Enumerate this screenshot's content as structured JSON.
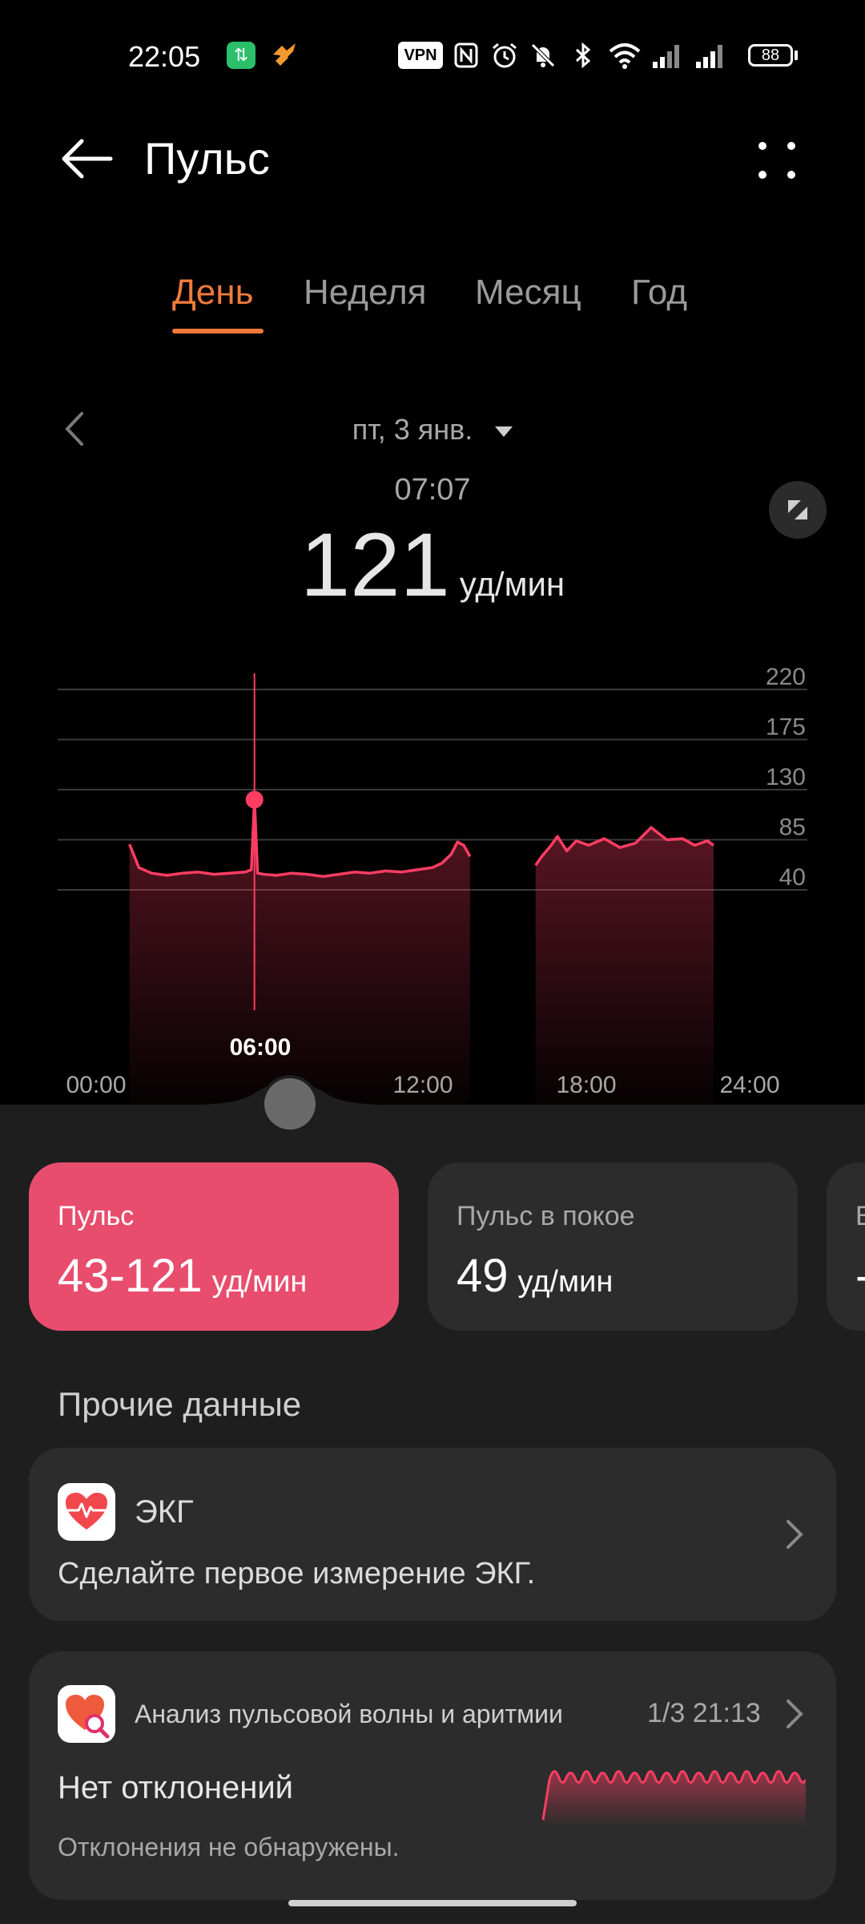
{
  "status_bar": {
    "time": "22:05",
    "icons": [
      "app-notification-green-icon",
      "app-notification-orange-icon",
      "vpn-badge",
      "nfc-icon",
      "alarm-icon",
      "mute-icon",
      "bluetooth-icon",
      "wifi-icon",
      "signal-1-icon",
      "signal-2-icon",
      "battery-icon"
    ],
    "vpn_label": "VPN",
    "battery": "88"
  },
  "header": {
    "title": "Пульс"
  },
  "tabs": [
    {
      "label": "День",
      "active": true
    },
    {
      "label": "Неделя",
      "active": false
    },
    {
      "label": "Месяц",
      "active": false
    },
    {
      "label": "Год",
      "active": false
    }
  ],
  "date_label": "пт, 3 янв.",
  "reading": {
    "time": "07:07",
    "value": "121",
    "unit": "уд/мин"
  },
  "chart_data": {
    "type": "area",
    "x_ticks": [
      "00:00",
      "06:00",
      "12:00",
      "18:00",
      "24:00"
    ],
    "y_ticks": [
      220,
      175,
      130,
      85,
      40
    ],
    "ylim": [
      40,
      220
    ],
    "color": "#ff3d63",
    "selected": {
      "time": "06:00",
      "value": 121
    },
    "series": [
      {
        "segment": 1,
        "x_hours": [
          2.3,
          2.6,
          3.0,
          3.5,
          4.0,
          4.5,
          5.0,
          5.5,
          6.0,
          6.2,
          6.3,
          6.4,
          6.6,
          7.0,
          7.5,
          8.0,
          8.5,
          9.0,
          9.5,
          10.0,
          10.5,
          11.0,
          11.5,
          12.0,
          12.3,
          12.6,
          12.8,
          13.0,
          13.2
        ],
        "values": [
          81,
          60,
          55,
          53,
          55,
          56,
          54,
          55,
          56,
          58,
          121,
          55,
          54,
          53,
          55,
          54,
          52,
          54,
          56,
          55,
          57,
          56,
          58,
          60,
          64,
          72,
          83,
          80,
          70
        ]
      },
      {
        "segment": 2,
        "x_hours": [
          15.3,
          15.5,
          15.8,
          16.0,
          16.3,
          16.6,
          17.0,
          17.5,
          18.0,
          18.5,
          19.0,
          19.5,
          20.0,
          20.4,
          20.8,
          21.0
        ],
        "values": [
          62,
          70,
          80,
          88,
          75,
          84,
          80,
          86,
          78,
          82,
          96,
          85,
          86,
          80,
          84,
          80
        ]
      }
    ]
  },
  "summary_cards": [
    {
      "label": "Пульс",
      "value": "43-121",
      "unit": "уд/мин"
    },
    {
      "label": "Пульс в покое",
      "value": "49",
      "unit": "уд/мин"
    },
    {
      "label": "В",
      "value": "-",
      "unit": ""
    }
  ],
  "section": {
    "title": "Прочие данные"
  },
  "ecg": {
    "title": "ЭКГ",
    "description": "Сделайте первое измерение ЭКГ."
  },
  "arrhythmia": {
    "title": "Анализ пульсовой волны и аритмии",
    "timestamp": "1/3 21:13",
    "status": "Нет отклонений",
    "description": "Отклонения не обнаружены."
  }
}
